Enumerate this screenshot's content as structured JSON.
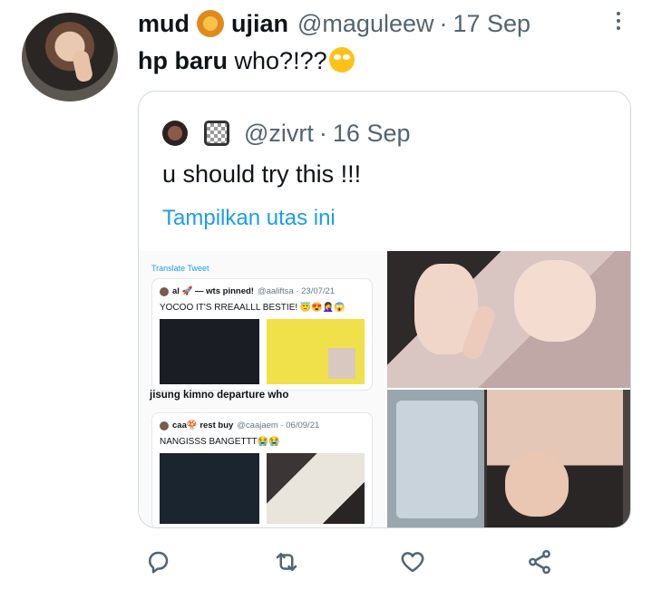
{
  "tweet": {
    "display_name_part1": "mud",
    "display_name_part2": "ujian",
    "name_emoji_icon": "lion-face-icon",
    "handle": "@maguleew",
    "separator": "·",
    "date": "17 Sep",
    "text_bold": "hp baru",
    "text_rest": "who?!??",
    "text_emoji_icon": "face-with-rolling-eyes-icon"
  },
  "quote": {
    "name_icon": "checker-flag-icon",
    "handle": "@zivrt",
    "separator": "·",
    "date": "16 Sep",
    "text": "u should try this !!!",
    "show_thread": "Tampilkan utas ini",
    "screenshot": {
      "translate_label": "Translate Tweet",
      "post1": {
        "name": "al 🚀 — wts pinned!",
        "handle": "@aaliftsa · 23/07/21",
        "text": "YOCOO IT'S RREAALLL BESTIE! 😇😍🤦‍♀️😱"
      },
      "caption": "jisung kimno departure who",
      "post2": {
        "name": "caa🍄 rest buy",
        "handle": "@caajaem · 06/09/21",
        "text": "NANGISSS BANGETTT😭😭"
      }
    }
  },
  "actions": {
    "reply_icon": "reply-icon",
    "retweet_icon": "retweet-icon",
    "like_icon": "heart-icon",
    "share_icon": "share-icon"
  },
  "colors": {
    "link": "#1d9bf0",
    "muted": "#536471",
    "border": "#cfd9de"
  }
}
